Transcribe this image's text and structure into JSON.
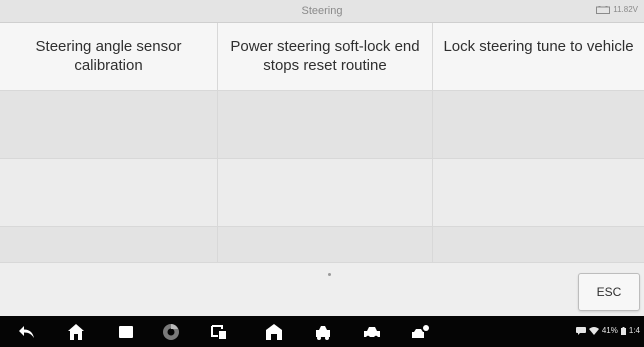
{
  "header": {
    "title": "Steering",
    "voltage": "11.82V"
  },
  "functions": [
    {
      "label": "Steering angle sensor calibration"
    },
    {
      "label": "Power steering soft-lock end stops reset routine"
    },
    {
      "label": "Lock steering tune to vehicle"
    }
  ],
  "footer": {
    "esc_label": "ESC"
  },
  "statusbar": {
    "battery_percent": "41%",
    "time": "1:4"
  },
  "icons": {
    "back": "back-arrow-icon",
    "home": "home-icon",
    "recent_apps": "recent-apps-icon",
    "browser": "chrome-icon",
    "screenshot": "screenshot-icon",
    "autel_home": "autel-home-icon",
    "vehicle": "car-icon",
    "vehicle_alt": "car-alt-icon",
    "service": "service-icon",
    "chat": "chat-icon",
    "wifi": "wifi-icon",
    "battery": "battery-icon"
  }
}
